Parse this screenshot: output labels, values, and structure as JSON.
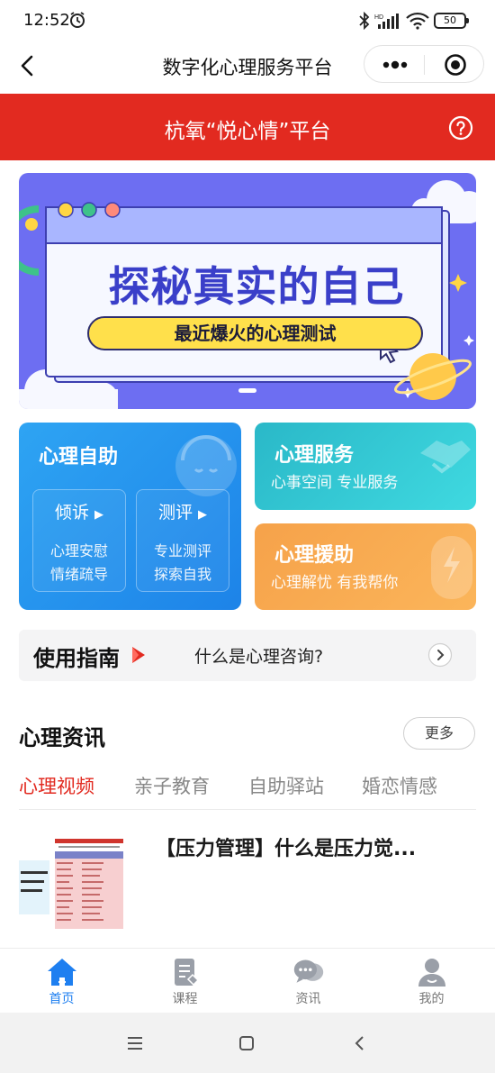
{
  "status_bar": {
    "time": "12:52",
    "battery": "50"
  },
  "nav": {
    "title": "数字化心理服务平台"
  },
  "header": {
    "title": "杭氧“悦心情”平台"
  },
  "banner": {
    "title": "探秘真实的自己",
    "subtitle": "最近爆火的心理测试"
  },
  "cards": {
    "self_help": {
      "title": "心理自助",
      "items": [
        {
          "label": "倾诉",
          "lines": [
            "心理安慰",
            "情绪疏导"
          ]
        },
        {
          "label": "测评",
          "lines": [
            "专业测评",
            "探索自我"
          ]
        }
      ]
    },
    "service": {
      "title": "心理服务",
      "subtitle": "心事空间 专业服务"
    },
    "aid": {
      "title": "心理援助",
      "subtitle": "心理解忧 有我帮你"
    }
  },
  "guide": {
    "label": "使用指南",
    "text": "什么是心理咨询?"
  },
  "news": {
    "title": "心理资讯",
    "more": "更多",
    "tabs": [
      "心理视频",
      "亲子教育",
      "自助驿站",
      "婚恋情感"
    ],
    "active_tab": 0,
    "articles": [
      {
        "title": "【压力管理】什么是压力觉..."
      }
    ]
  },
  "tabbar": {
    "items": [
      {
        "label": "首页",
        "icon": "home-icon",
        "active": true
      },
      {
        "label": "课程",
        "icon": "course-icon",
        "active": false
      },
      {
        "label": "资讯",
        "icon": "chat-icon",
        "active": false
      },
      {
        "label": "我的",
        "icon": "user-icon",
        "active": false
      }
    ]
  },
  "colors": {
    "brand_red": "#e22a20",
    "active_blue": "#1e7ff0",
    "banner_purple": "#6d6ef2"
  }
}
